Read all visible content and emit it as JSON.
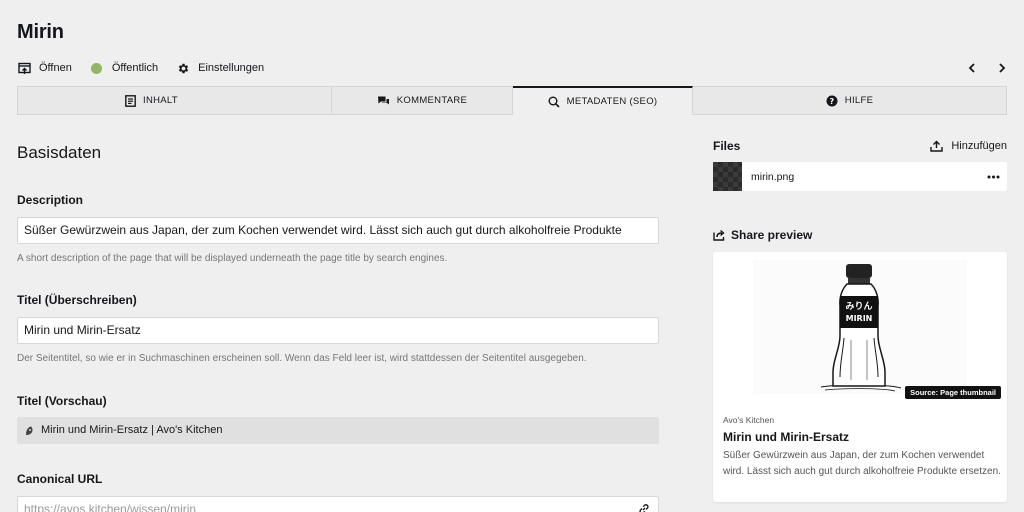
{
  "page": {
    "title": "Mirin"
  },
  "actions": {
    "open_label": "Öffnen",
    "status_label": "Öffentlich",
    "status_color": "#91b763",
    "settings_label": "Einstellungen"
  },
  "tabs": [
    {
      "label": "INHALT",
      "icon": "content-icon"
    },
    {
      "label": "KOMMENTARE",
      "icon": "comments-icon"
    },
    {
      "label": "METADATEN (SEO)",
      "icon": "search-icon",
      "active": true
    },
    {
      "label": "HILFE",
      "icon": "help-icon"
    }
  ],
  "main": {
    "section_title": "Basisdaten",
    "description": {
      "label": "Description",
      "value": "Süßer Gewürzwein aus Japan, der zum Kochen verwendet wird. Lässt sich auch gut durch alkoholfreie Produkte",
      "help": "A short description of the page that will be displayed underneath the page title by search engines."
    },
    "title_override": {
      "label": "Titel (Überschreiben)",
      "value": "Mirin und Mirin-Ersatz",
      "help": "Der Seitentitel, so wie er in Suchmaschinen erscheinen soll. Wenn das Feld leer ist, wird stattdessen der Seitentitel ausgegeben."
    },
    "title_preview": {
      "label": "Titel (Vorschau)",
      "value": "Mirin und Mirin-Ersatz | Avo's Kitchen"
    },
    "canonical": {
      "label": "Canonical URL",
      "placeholder": "https://avos.kitchen/wissen/mirin"
    }
  },
  "sidebar": {
    "files_label": "Files",
    "add_label": "Hinzufügen",
    "files": [
      {
        "name": "mirin.png"
      }
    ],
    "share_label": "Share preview",
    "share": {
      "image_badge": "Source: Page thumbnail",
      "image_text_top": "みりん",
      "image_text_bottom": "MIRIN",
      "site": "Avo's Kitchen",
      "title": "Mirin und Mirin-Ersatz",
      "description": "Süßer Gewürzwein aus Japan, der zum Kochen verwendet wird. Lässt sich auch gut durch alkoholfreie Produkte ersetzen."
    }
  }
}
